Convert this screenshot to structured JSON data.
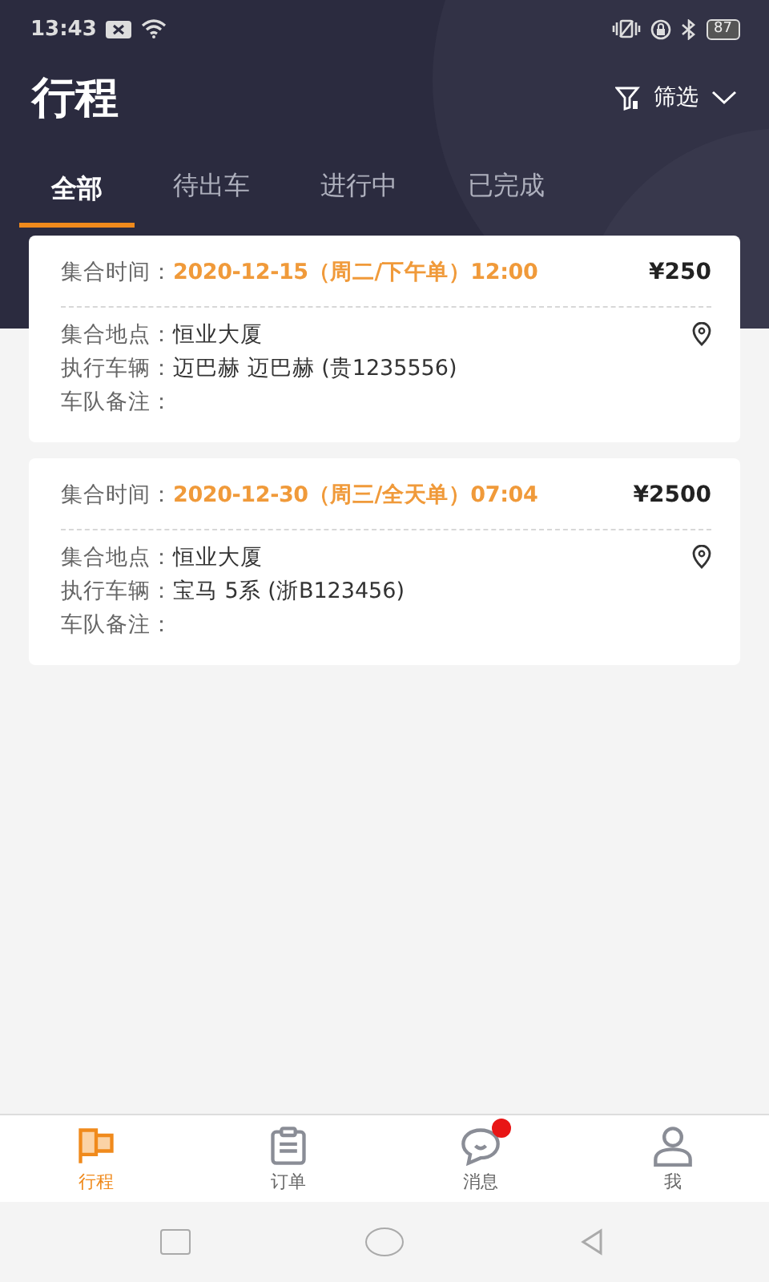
{
  "status_bar": {
    "time": "13:43",
    "battery": "87"
  },
  "header": {
    "title": "行程",
    "filter": {
      "label": "筛选"
    }
  },
  "tabs": [
    {
      "label": "全部",
      "selected": true
    },
    {
      "label": "待出车",
      "selected": false
    },
    {
      "label": "进行中",
      "selected": false
    },
    {
      "label": "已完成",
      "selected": false
    }
  ],
  "trips": [
    {
      "time_label": "集合时间：",
      "time": "2020-12-15（周二/下午单）12:00",
      "price": "¥250",
      "fields": [
        {
          "label": "集合地点：",
          "value": "恒业大厦",
          "has_location": true
        },
        {
          "label": "执行车辆：",
          "value": "迈巴赫 迈巴赫 (贵1235556)",
          "has_location": false
        },
        {
          "label": "车队备注：",
          "has_location": false
        }
      ]
    },
    {
      "time_label": "集合时间：",
      "time": "2020-12-30（周三/全天单）07:04",
      "price": "¥2500",
      "fields": [
        {
          "label": "集合地点：",
          "value": "恒业大厦",
          "has_location": true
        },
        {
          "label": "执行车辆：",
          "value": "宝马 5系 (浙B123456)",
          "has_location": false
        },
        {
          "label": "车队备注：",
          "has_location": false
        }
      ]
    }
  ],
  "bottom_nav": [
    {
      "label": "行程",
      "selected": true,
      "badge": false
    },
    {
      "label": "订单",
      "selected": false,
      "badge": false
    },
    {
      "label": "消息",
      "selected": false,
      "badge": true
    },
    {
      "label": "我",
      "selected": false,
      "badge": false
    }
  ]
}
